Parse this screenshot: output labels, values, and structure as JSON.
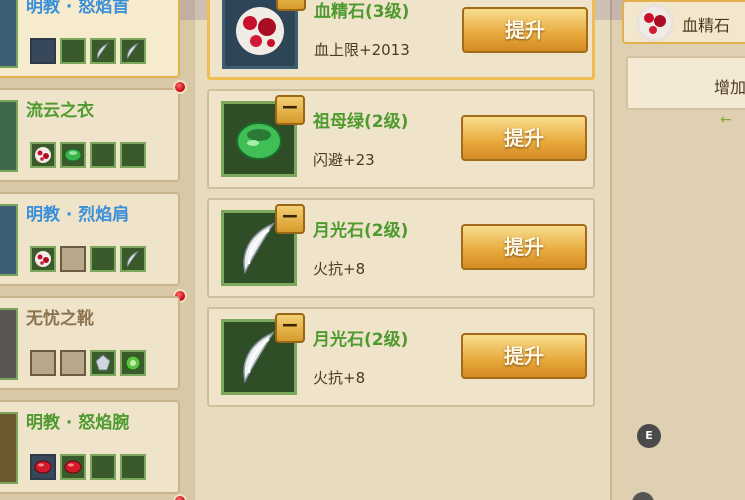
{
  "equipment_list": [
    {
      "name": "明教 · 怒焰首",
      "color": "#3a8fd9",
      "slots": [
        "empty-blue",
        "empty-green",
        "moonstone",
        "moonstone"
      ]
    },
    {
      "name": "流云之衣",
      "color": "#4e9a2f",
      "slots": [
        "bloodstone",
        "emerald",
        "empty-green",
        "empty-green"
      ]
    },
    {
      "name": "明教 · 烈焰肩",
      "color": "#3a8fd9",
      "slots": [
        "bloodstone",
        "empty-tan",
        "empty-green",
        "moonstone"
      ]
    },
    {
      "name": "无忧之靴",
      "color": "#8b7350",
      "slots": [
        "empty-tan",
        "empty-tan",
        "silver-gem",
        "green-gem"
      ]
    },
    {
      "name": "明教 · 怒焰腕",
      "color": "#4e9a2f",
      "slots": [
        "ruby",
        "ruby",
        "empty-green",
        "empty-green"
      ]
    }
  ],
  "gems": [
    {
      "name": "血精石(3级)",
      "stat": "血上限+2013",
      "icon": "bloodstone-icon",
      "button": "提升",
      "selected": true
    },
    {
      "name": "祖母绿(2级)",
      "stat": "闪避+23",
      "icon": "emerald-ring-icon",
      "button": "提升",
      "selected": false
    },
    {
      "name": "月光石(2级)",
      "stat": "火抗+8",
      "icon": "moonstone-icon",
      "button": "提升",
      "selected": false
    },
    {
      "name": "月光石(2级)",
      "stat": "火抗+8",
      "icon": "moonstone-icon",
      "button": "提升",
      "selected": false
    }
  ],
  "right_panel": {
    "header_label": "血精石",
    "add_label": "增加",
    "arrow": "←"
  },
  "corner_badge": "E",
  "colors": {
    "gem_name_green": "#4e9a2f",
    "button_gold": "#e8a93c",
    "selected_border": "#f0bd52"
  }
}
